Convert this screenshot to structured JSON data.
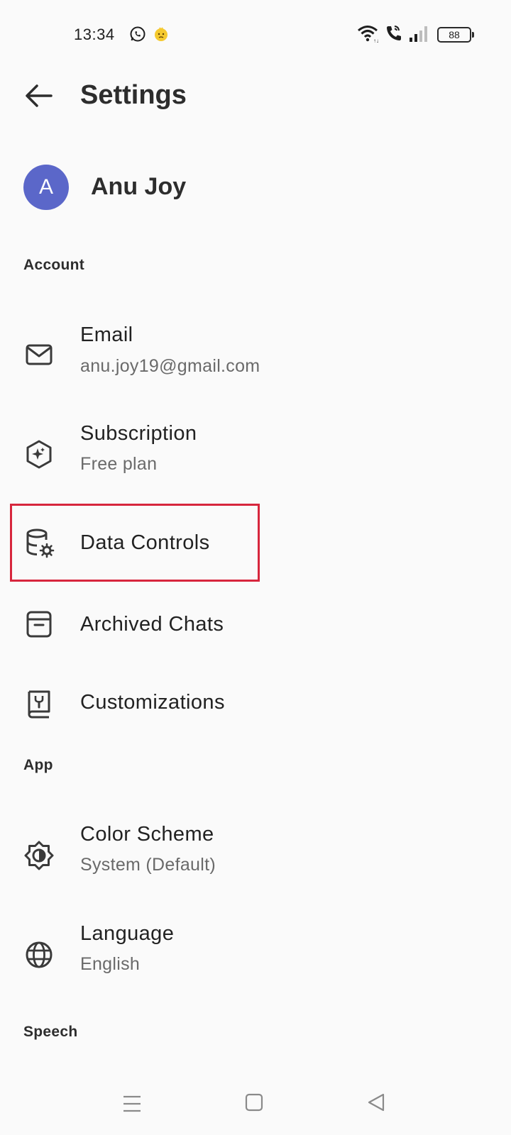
{
  "status_bar": {
    "time": "13:34",
    "battery": "88",
    "icons": [
      "whatsapp-icon",
      "emoji-icon",
      "wifi-icon",
      "wifi-call-icon",
      "signal-icon",
      "battery-icon"
    ]
  },
  "header": {
    "title": "Settings",
    "back_icon": "arrow-left-icon"
  },
  "profile": {
    "initial": "A",
    "name": "Anu Joy",
    "avatar_color": "#5b67c9"
  },
  "sections": {
    "account": "Account",
    "app": "App",
    "speech": "Speech"
  },
  "account_items": [
    {
      "title": "Email",
      "subtitle": "anu.joy19@gmail.com",
      "icon": "mail-icon"
    },
    {
      "title": "Subscription",
      "subtitle": "Free plan",
      "icon": "sparkle-badge-icon"
    },
    {
      "title": "Data Controls",
      "icon": "database-settings-icon"
    },
    {
      "title": "Archived Chats",
      "icon": "archive-box-icon"
    },
    {
      "title": "Customizations",
      "icon": "book-tools-icon"
    }
  ],
  "app_items": [
    {
      "title": "Color Scheme",
      "subtitle": "System (Default)",
      "icon": "brightness-icon"
    },
    {
      "title": "Language",
      "subtitle": "English",
      "icon": "globe-icon"
    }
  ],
  "highlight_color": "#d7263d",
  "nav_bar": {
    "icons": [
      "menu-icon",
      "home-square-icon",
      "back-triangle-icon"
    ]
  }
}
